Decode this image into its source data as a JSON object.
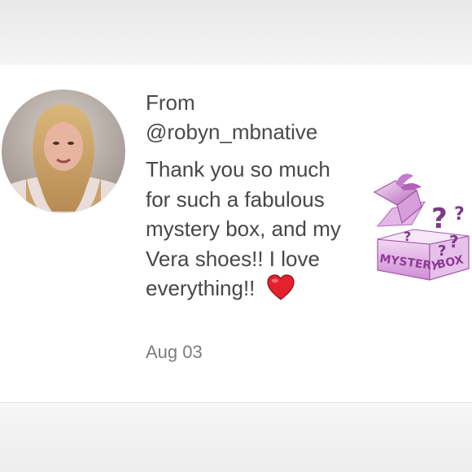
{
  "review": {
    "from_label": "From",
    "handle": "@robyn_mbnative",
    "message": "Thank you so much for such a fabulous mystery box, and my Vera shoes!! I love everything!!",
    "date": "Aug 03"
  },
  "image": {
    "box_text_left": "MYSTERY",
    "box_text_right": "BOX",
    "accent_color": "#b24fb9"
  }
}
